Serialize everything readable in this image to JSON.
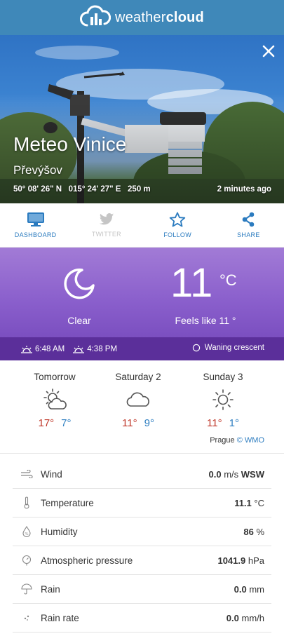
{
  "header": {
    "brand_light": "weather",
    "brand_bold": "cloud"
  },
  "hero": {
    "station_name": "Meteo Vinice",
    "place": "Převýšov",
    "coords": "50° 08' 26\" N   015° 24' 27\" E   250 m",
    "updated": "2 minutes ago"
  },
  "actions": [
    {
      "label": "DASHBOARD",
      "icon": "monitor-icon",
      "enabled": true
    },
    {
      "label": "TWITTER",
      "icon": "twitter-icon",
      "enabled": false
    },
    {
      "label": "FOLLOW",
      "icon": "star-icon",
      "enabled": true
    },
    {
      "label": "SHARE",
      "icon": "share-icon",
      "enabled": true
    }
  ],
  "current": {
    "condition": "Clear",
    "temperature": "11",
    "unit": "°C",
    "feels_like": "Feels like 11 °",
    "sunrise": "6:48 AM",
    "sunset": "4:38 PM",
    "moon_phase": "Waning crescent"
  },
  "forecast": {
    "days": [
      {
        "name": "Tomorrow",
        "icon": "sun-cloud-icon",
        "max": "17°",
        "min": "7°"
      },
      {
        "name": "Saturday 2",
        "icon": "cloud-icon",
        "max": "11°",
        "min": "9°"
      },
      {
        "name": "Sunday 3",
        "icon": "sun-icon",
        "max": "11°",
        "min": "1°"
      }
    ],
    "source_city": "Prague",
    "source_link": "© WMO"
  },
  "sensors": [
    {
      "label": "Wind",
      "icon": "wind-icon",
      "value": "0.0",
      "unit": "m/s",
      "extra": "WSW"
    },
    {
      "label": "Temperature",
      "icon": "thermometer-icon",
      "value": "11.1",
      "unit": "°C",
      "extra": ""
    },
    {
      "label": "Humidity",
      "icon": "humidity-drop-icon",
      "value": "86",
      "unit": "%",
      "extra": ""
    },
    {
      "label": "Atmospheric pressure",
      "icon": "pressure-icon",
      "value": "1041.9",
      "unit": "hPa",
      "extra": ""
    },
    {
      "label": "Rain",
      "icon": "umbrella-icon",
      "value": "0.0",
      "unit": "mm",
      "extra": ""
    },
    {
      "label": "Rain rate",
      "icon": "rain-rate-icon",
      "value": "0.0",
      "unit": "mm/h",
      "extra": ""
    }
  ],
  "colors": {
    "header": "#3f88b9",
    "accent": "#2b7bbf",
    "purple": "#8a5fcc",
    "purple_dark": "#5b2f9a",
    "max_temp": "#c0392b",
    "min_temp": "#2f7fc1"
  }
}
